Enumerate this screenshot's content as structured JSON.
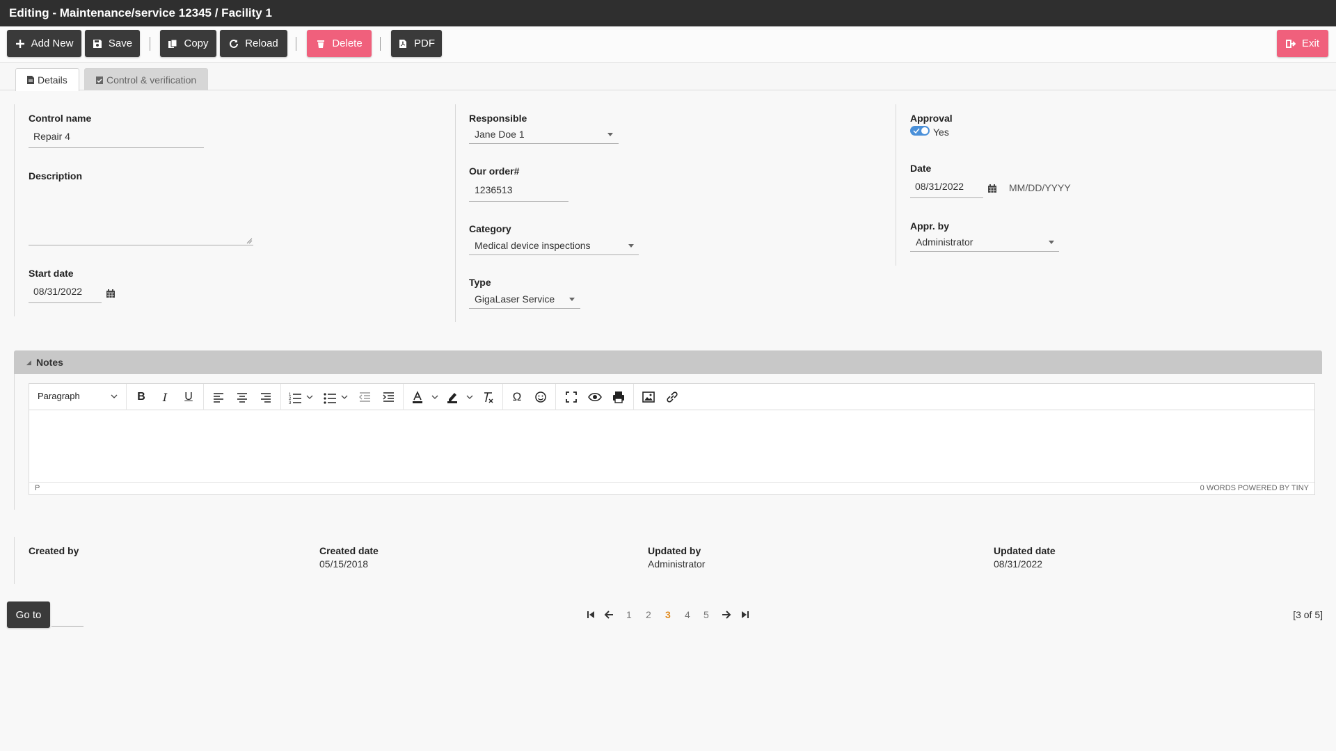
{
  "window": {
    "title": "Editing - Maintenance/service 12345 / Facility 1"
  },
  "toolbar": {
    "add_new": "Add New",
    "save": "Save",
    "copy": "Copy",
    "reload": "Reload",
    "delete": "Delete",
    "pdf": "PDF",
    "exit": "Exit"
  },
  "tabs": [
    {
      "label": "Details",
      "active": true
    },
    {
      "label": "Control & verification",
      "active": false
    }
  ],
  "form": {
    "control_name": {
      "label": "Control name",
      "value": "Repair 4"
    },
    "description": {
      "label": "Description",
      "value": ""
    },
    "start_date": {
      "label": "Start date",
      "value": "08/31/2022"
    },
    "responsible": {
      "label": "Responsible",
      "value": "Jane Doe 1"
    },
    "our_order": {
      "label": "Our order#",
      "value": "1236513"
    },
    "category": {
      "label": "Category",
      "value": "Medical device inspections"
    },
    "type": {
      "label": "Type",
      "value": "GigaLaser Service"
    },
    "approval": {
      "label": "Approval",
      "value": "Yes",
      "checked": true
    },
    "date": {
      "label": "Date",
      "value": "08/31/2022",
      "format_hint": "MM/DD/YYYY"
    },
    "appr_by": {
      "label": "Appr. by",
      "value": "Administrator"
    }
  },
  "notes": {
    "title": "Notes",
    "block_format": "Paragraph",
    "status_path": "P",
    "word_count": "0 WORDS",
    "powered_by": "POWERED BY TINY"
  },
  "audit": {
    "created_by": {
      "label": "Created by",
      "value": ""
    },
    "created_date": {
      "label": "Created date",
      "value": "05/15/2018"
    },
    "updated_by": {
      "label": "Updated by",
      "value": "Administrator"
    },
    "updated_date": {
      "label": "Updated date",
      "value": "08/31/2022"
    }
  },
  "pagination": {
    "go_to": "Go to",
    "pages": [
      "1",
      "2",
      "3",
      "4",
      "5"
    ],
    "current": "3",
    "summary": "[3 of 5]"
  },
  "colors": {
    "title_bg": "#2f2f2f",
    "button_dark": "#3a3a3a",
    "button_pink": "#f0607c",
    "active_page": "#e08a1e",
    "toggle": "#4a90d9"
  }
}
